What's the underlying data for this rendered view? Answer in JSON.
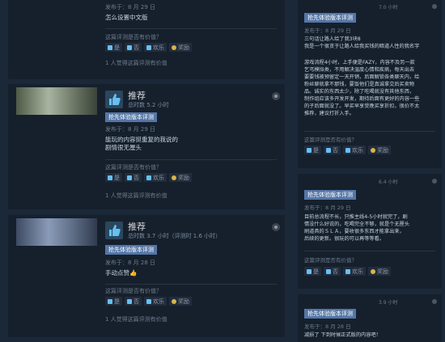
{
  "left": {
    "card1": {
      "posted": "发布于：8 月 29 日",
      "text": "怎么设置中文版",
      "helpful_q": "这篇评测是否有价值？",
      "buttons": {
        "yes": "是",
        "no": "否",
        "funny": "欢乐",
        "award": "奖励"
      },
      "count": "1 人觉得这篇评测有价值"
    },
    "card2": {
      "verdict": "推荐",
      "hours": "总时数 5.2 小时",
      "tag": "抢先体验版本评测",
      "posted": "发布于：8 月 29 日",
      "lines": [
        "能玩的内容挺重复的我说的",
        "剧情很无厘头"
      ],
      "helpful_q": "这篇评测是否有价值？",
      "buttons": {
        "yes": "是",
        "no": "否",
        "funny": "欢乐",
        "award": "奖励"
      },
      "count": "1 人觉得这篇评测有价值"
    },
    "card3": {
      "verdict": "推荐",
      "hours": "总时数 3.7 小时（评测时 1.6 小时）",
      "tag": "抢先体验版本评测",
      "posted": "发布于：8 月 28 日",
      "text": "手动点赞👍",
      "helpful_q": "这篇评测是否有价值？",
      "buttons": {
        "yes": "是",
        "no": "否",
        "funny": "欢乐",
        "award": "奖励"
      },
      "count": "1 人觉得这篇评测有价值"
    }
  },
  "right": {
    "card1": {
      "time": "7.0 小时",
      "tag": "抢先体验版本评测",
      "posted": "发布于：8 月 29 日",
      "lines": [
        "三句话让路人给了我3块8",
        "我是一个很贪于让路人给我买钱的暗道人性的我名字",
        "游戏流程4小时，上手便是FAZY，内容不及另一款",
        "乞丐模拟类，不用解决温度心情和疾病，每天出去",
        "要要钱被预留定一天开销，后面解锁各类聊天内，给",
        "粉丝聊就拿不那钱，要饭他们是真诚拿交后买卖物",
        "品。诚实的东西太少，除了吃喝就没有其他东西，",
        "制作组应该多开发开发，期待后面有更好的内容一些",
        "的子后面就没了。早买早享受晚买享折扣，很价不太",
        "推荐，建议打折入手。"
      ],
      "helpful_q": "这篇评测是否有价值？",
      "buttons": {
        "yes": "是",
        "no": "否",
        "funny": "欢乐",
        "award": "奖励"
      }
    },
    "card2": {
      "time": "6.4 小时",
      "tag": "抢先体验版本评测",
      "posted": "发布于：8 月 29 日",
      "lines": [
        "目前总流程不长，只推主线4-5小时就完了，剧",
        "情没什么好说的，吃喝完全不够，就是个无厘头",
        "刷道具的ＳＬＡ，要收很多东西才能拿出来，",
        "后续的更新。很玩的可以再等等看。"
      ],
      "helpful_q": "这篇评测是否有价值？",
      "buttons": {
        "yes": "是",
        "no": "否",
        "funny": "欢乐",
        "award": "奖励"
      }
    },
    "card3": {
      "time": "3.9 小时",
      "tag": "抢先体验版本评测",
      "posted": "发布于：8 月 28 日",
      "text": "减损了    下到时候正式版的内容吧！"
    }
  }
}
